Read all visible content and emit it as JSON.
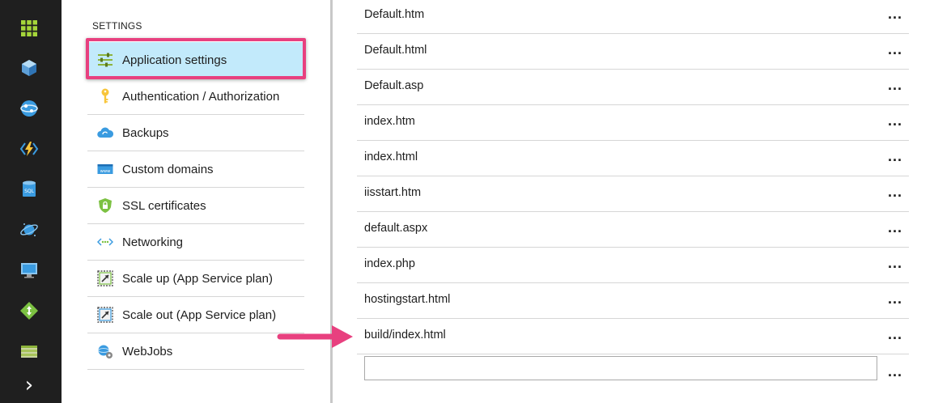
{
  "rail": {
    "icons": [
      "all-resources-grid-icon",
      "resource-groups-cube-icon",
      "app-services-globe-icon",
      "function-apps-bolt-icon",
      "sql-database-icon",
      "cosmos-db-planet-icon",
      "virtual-machines-monitor-icon",
      "load-balancer-diamond-icon",
      "storage-accounts-icon",
      "expand-chevron-icon"
    ],
    "expand_glyph": "›"
  },
  "settings": {
    "heading": "SETTINGS",
    "items": [
      {
        "label": "Application settings",
        "icon": "sliders-icon",
        "active": true
      },
      {
        "label": "Authentication / Authorization",
        "icon": "key-icon"
      },
      {
        "label": "Backups",
        "icon": "cloud-icon"
      },
      {
        "label": "Custom domains",
        "icon": "www-icon"
      },
      {
        "label": "SSL certificates",
        "icon": "shield-lock-icon"
      },
      {
        "label": "Networking",
        "icon": "networking-icon"
      },
      {
        "label": "Scale up (App Service plan)",
        "icon": "scale-up-icon"
      },
      {
        "label": "Scale out (App Service plan)",
        "icon": "scale-out-icon"
      },
      {
        "label": "WebJobs",
        "icon": "webjobs-gears-icon"
      }
    ]
  },
  "default_documents": {
    "items": [
      "Default.htm",
      "Default.html",
      "Default.asp",
      "index.htm",
      "index.html",
      "iisstart.htm",
      "default.aspx",
      "index.php",
      "hostingstart.html",
      "build/index.html"
    ],
    "more_label": "...",
    "new_value": ""
  },
  "colors": {
    "rail_bg": "#1f1f1f",
    "active_bg": "#c2eafb",
    "highlight": "#e8407f",
    "arrow": "#e8407f"
  }
}
